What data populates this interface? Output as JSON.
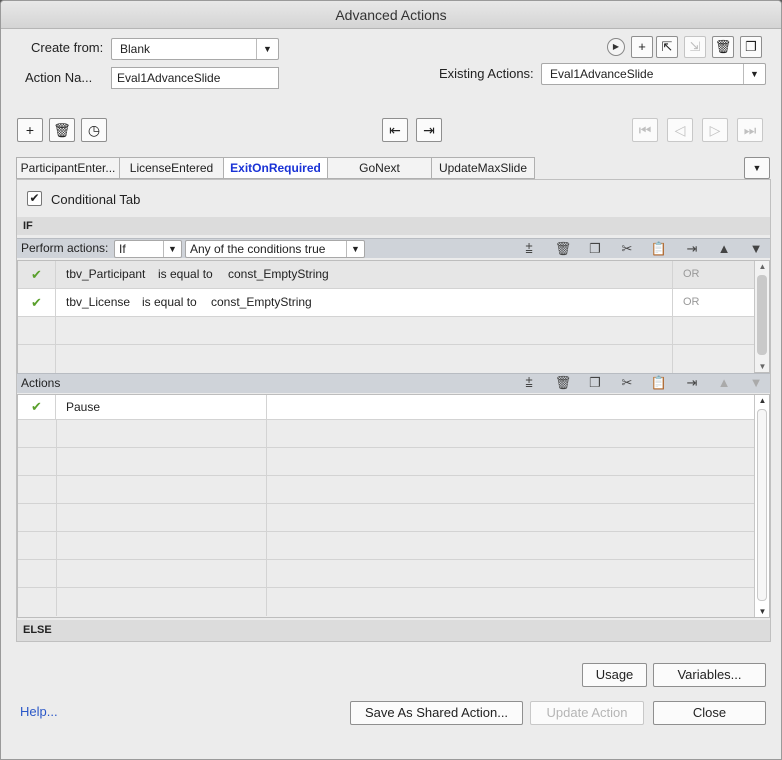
{
  "window": {
    "title": "Advanced Actions"
  },
  "top": {
    "create_from_label": "Create from:",
    "create_from_value": "Blank",
    "action_name_label": "Action Na...",
    "action_name_value": "Eval1AdvanceSlide",
    "existing_label": "Existing Actions:",
    "existing_value": "Eval1AdvanceSlide"
  },
  "decision_tabs": [
    "ParticipantEnter...",
    "LicenseEntered",
    "ExitOnRequired",
    "GoNext",
    "UpdateMaxSlide"
  ],
  "active_tab": "ExitOnRequired",
  "conditional": {
    "label": "Conditional Tab",
    "checked": true
  },
  "if_label": "IF",
  "perform": {
    "label": "Perform actions:",
    "mode_value": "If",
    "condition_value": "Any of the conditions true"
  },
  "conditions": [
    {
      "var": "tbv_Participant",
      "op": "is equal to",
      "val": "const_EmptyString",
      "join": "OR"
    },
    {
      "var": "tbv_License",
      "op": "is equal to",
      "val": "const_EmptyString",
      "join": "OR"
    }
  ],
  "actions_label": "Actions",
  "actions": [
    {
      "name": "Pause"
    }
  ],
  "else_label": "ELSE",
  "buttons": {
    "usage": "Usage",
    "variables": "Variables...",
    "help": "Help...",
    "save_shared": "Save As Shared Action...",
    "update": "Update Action",
    "close": "Close"
  },
  "icons": {
    "check": "✔",
    "dropdown": "▼",
    "play": "▶"
  }
}
